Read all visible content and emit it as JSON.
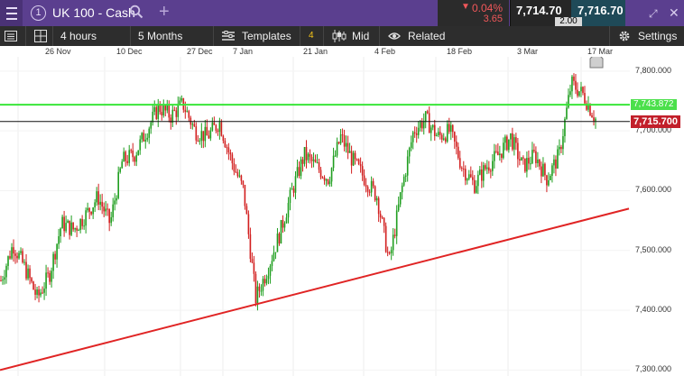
{
  "topbar": {
    "instrument_number": "1",
    "instrument_name": "UK 100 - Cash",
    "change_percent": "0.04%",
    "change_points": "3.65",
    "bid": "7,714.70",
    "spread": "2.00",
    "ask": "7,716.70"
  },
  "toolbar": {
    "interval": "4 hours",
    "range": "5 Months",
    "templates_label": "Templates",
    "templates_count": "4",
    "price_type": "Mid",
    "related_label": "Related",
    "settings_label": "Settings"
  },
  "chart": {
    "x_labels": [
      "26 Nov",
      "10 Dec",
      "27 Dec",
      "7 Jan",
      "21 Jan",
      "4 Feb",
      "18 Feb",
      "3 Mar",
      "17 Mar"
    ],
    "y_labels": [
      "7,800.000",
      "7,700.000",
      "7,600.000",
      "7,500.000",
      "7,400.000",
      "7,300.000"
    ],
    "green_level_label": "7,743.872",
    "current_price_label": "7,715.700",
    "colors": {
      "up": "#1f9e1f",
      "down": "#d21f1f",
      "horizontal": "#39e639",
      "trendline": "#e02424",
      "price_line": "#111111"
    }
  },
  "chart_data": {
    "type": "candlestick",
    "ylim": [
      7290,
      7830
    ],
    "x_labels": [
      "26 Nov",
      "10 Dec",
      "27 Dec",
      "7 Jan",
      "21 Jan",
      "4 Feb",
      "18 Feb",
      "3 Mar",
      "17 Mar"
    ],
    "y_ticks": [
      7800,
      7700,
      7600,
      7500,
      7400,
      7300
    ],
    "anchors_close": [
      7450,
      7510,
      7470,
      7420,
      7460,
      7545,
      7535,
      7560,
      7590,
      7545,
      7650,
      7660,
      7700,
      7740,
      7725,
      7745,
      7700,
      7690,
      7715,
      7650,
      7600,
      7420,
      7470,
      7530,
      7600,
      7660,
      7640,
      7620,
      7690,
      7650,
      7620,
      7590,
      7480,
      7600,
      7700,
      7720,
      7690,
      7700,
      7640,
      7610,
      7640,
      7660,
      7690,
      7640,
      7660,
      7620,
      7660,
      7780,
      7760,
      7720
    ],
    "horizontal_levels": [
      7743.872,
      7715.7
    ],
    "trendline": [
      [
        0,
        7300
      ],
      [
        697,
        7570
      ]
    ]
  }
}
